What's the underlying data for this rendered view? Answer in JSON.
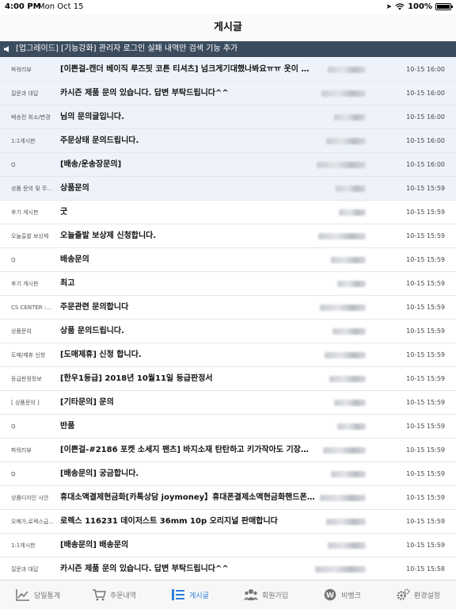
{
  "status": {
    "time": "4:00 PM",
    "date": "Mon Oct 15",
    "battery": "100%"
  },
  "nav": {
    "title": "게시글"
  },
  "notice": {
    "text": "[업그레이드] [기능강화] 관리자 로그인 실패 내역만 검색 기능 추가"
  },
  "posts": [
    {
      "category": "파워리뷰",
      "title": "[이쁜걸-캔더 베이직 루즈핏 코튼 티셔츠] 넘크게기대했나봐요ㅠㅠ 옷이 너무…",
      "date": "10-15 16:00"
    },
    {
      "category": "질문과 대답",
      "title": "카시즌 제품 문의 있습니다. 답변 부탁드립니다^^",
      "date": "10-15 16:00"
    },
    {
      "category": "배송전 취소/변경",
      "title": "님의 문의글입니다.",
      "date": "10-15 16:00"
    },
    {
      "category": "1:1게시판",
      "title": "주문상태 문의드립니다.",
      "date": "10-15 16:00"
    },
    {
      "category": "Q",
      "title": "[배송/운송장문의]",
      "date": "10-15 16:00"
    },
    {
      "category": "상품 문의 및 무…",
      "title": "상품문의",
      "date": "10-15 15:59"
    },
    {
      "category": "후기 게시판",
      "title": "굿",
      "date": "10-15 15:59"
    },
    {
      "category": "오늘출발 보상제",
      "title": "오늘출발 보상제 신청합니다.",
      "date": "10-15 15:59"
    },
    {
      "category": "Q",
      "title": "배송문의",
      "date": "10-15 15:59"
    },
    {
      "category": "후기 게시판",
      "title": "최고",
      "date": "10-15 15:59"
    },
    {
      "category": "CS CENTER :…",
      "title": " 주문관련 문의합니다",
      "date": "10-15 15:59"
    },
    {
      "category": "상품문의",
      "title": "상품 문의드립니다.",
      "date": "10-15 15:59"
    },
    {
      "category": "도매/제휴 신청",
      "title": "[도매제휴] 신청 합니다.",
      "date": "10-15 15:59"
    },
    {
      "category": "등급판정정보",
      "title": "[한우1등급] 2018년 10월11일 등급판정서",
      "date": "10-15 15:59"
    },
    {
      "category": "[ 상품문의 ]",
      "title": "[기타문의] 문의",
      "date": "10-15 15:59"
    },
    {
      "category": "Q",
      "title": "반품",
      "date": "10-15 15:59"
    },
    {
      "category": "파워리뷰",
      "title": "[이쁜걸-#2186 포켓 소세지 팬츠] 바지소재 탄탄하고 키가작아도 기장수선…",
      "date": "10-15 15:59"
    },
    {
      "category": "Q",
      "title": "[배송문의] 궁금합니다.",
      "date": "10-15 15:59"
    },
    {
      "category": "상품디자인 시안",
      "title": "휴대소액결제현금화[카톡상담 joymoney】휴대폰결제소액현금화핸드폰결…",
      "date": "10-15 15:59"
    },
    {
      "category": "오메가,로렉스급…",
      "title": "로렉스 116231 데이저스트 36mm 10p 오리지널 판매합니다",
      "date": "10-15 15:59"
    },
    {
      "category": "1:1게시판",
      "title": "[배송문의] 배송문의",
      "date": "10-15 15:59"
    },
    {
      "category": "질문과 대답",
      "title": "카시즌 제품 문의 있습니다. 답변 부탁드립니다^^",
      "date": "10-15 15:58"
    }
  ],
  "tabs": [
    {
      "label": "당일통계",
      "icon": "chart-icon"
    },
    {
      "label": "주문내역",
      "icon": "cart-icon"
    },
    {
      "label": "게시글",
      "icon": "list-icon"
    },
    {
      "label": "회원가입",
      "icon": "members-icon"
    },
    {
      "label": "비뱅크",
      "icon": "won-icon"
    },
    {
      "label": "환경설정",
      "icon": "gear-icon"
    }
  ],
  "colors": {
    "accent": "#2f7fd8",
    "notice_bg": "#3b4c5f",
    "highlight_row": "#eef3fb"
  }
}
